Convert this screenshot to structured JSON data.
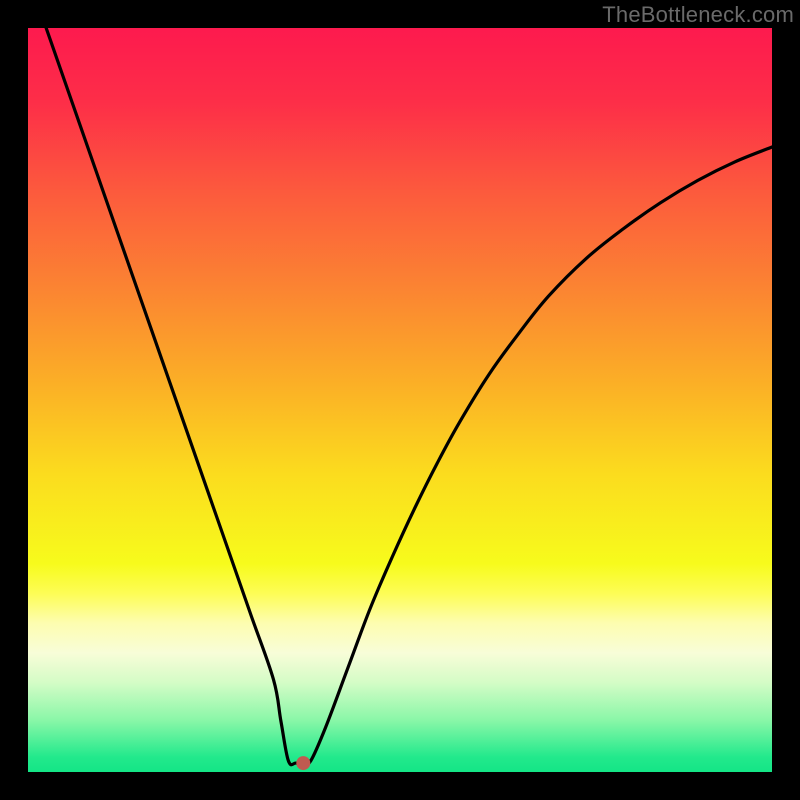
{
  "watermark": "TheBottleneck.com",
  "chart_data": {
    "type": "line",
    "title": "",
    "xlabel": "",
    "ylabel": "",
    "xlim": [
      0,
      100
    ],
    "ylim": [
      0,
      100
    ],
    "series": [
      {
        "name": "bottleneck-curve",
        "x": [
          0,
          3,
          6,
          9,
          12,
          15,
          18,
          21,
          24,
          27,
          30,
          33,
          34,
          35,
          36,
          37,
          38,
          40,
          43,
          46,
          49,
          52,
          55,
          58,
          62,
          66,
          70,
          75,
          80,
          85,
          90,
          95,
          100
        ],
        "values": [
          107,
          98.4,
          89.8,
          81.2,
          72.6,
          64,
          55.4,
          46.8,
          38.2,
          29.6,
          21,
          12.4,
          6.8,
          1.5,
          1.2,
          1.2,
          1.5,
          6,
          14,
          22,
          29,
          35.5,
          41.5,
          47,
          53.5,
          59,
          64,
          69,
          73,
          76.5,
          79.5,
          82,
          84
        ]
      }
    ],
    "markers": [
      {
        "name": "optimal-point",
        "x": 37,
        "y": 1.2,
        "color": "#c05a50"
      }
    ],
    "background_gradient": {
      "type": "vertical-rainbow",
      "stops": [
        {
          "pos": 0.0,
          "color": "#fd1a4e"
        },
        {
          "pos": 0.1,
          "color": "#fd2e48"
        },
        {
          "pos": 0.22,
          "color": "#fc5a3d"
        },
        {
          "pos": 0.35,
          "color": "#fb8432"
        },
        {
          "pos": 0.48,
          "color": "#fbb026"
        },
        {
          "pos": 0.6,
          "color": "#fbdc1e"
        },
        {
          "pos": 0.72,
          "color": "#f7fb1c"
        },
        {
          "pos": 0.76,
          "color": "#fdfd56"
        },
        {
          "pos": 0.8,
          "color": "#fdfdb0"
        },
        {
          "pos": 0.84,
          "color": "#f8fdd8"
        },
        {
          "pos": 0.88,
          "color": "#d4fcc6"
        },
        {
          "pos": 0.93,
          "color": "#8af7a8"
        },
        {
          "pos": 0.98,
          "color": "#22e98c"
        },
        {
          "pos": 1.0,
          "color": "#14e586"
        }
      ]
    }
  }
}
